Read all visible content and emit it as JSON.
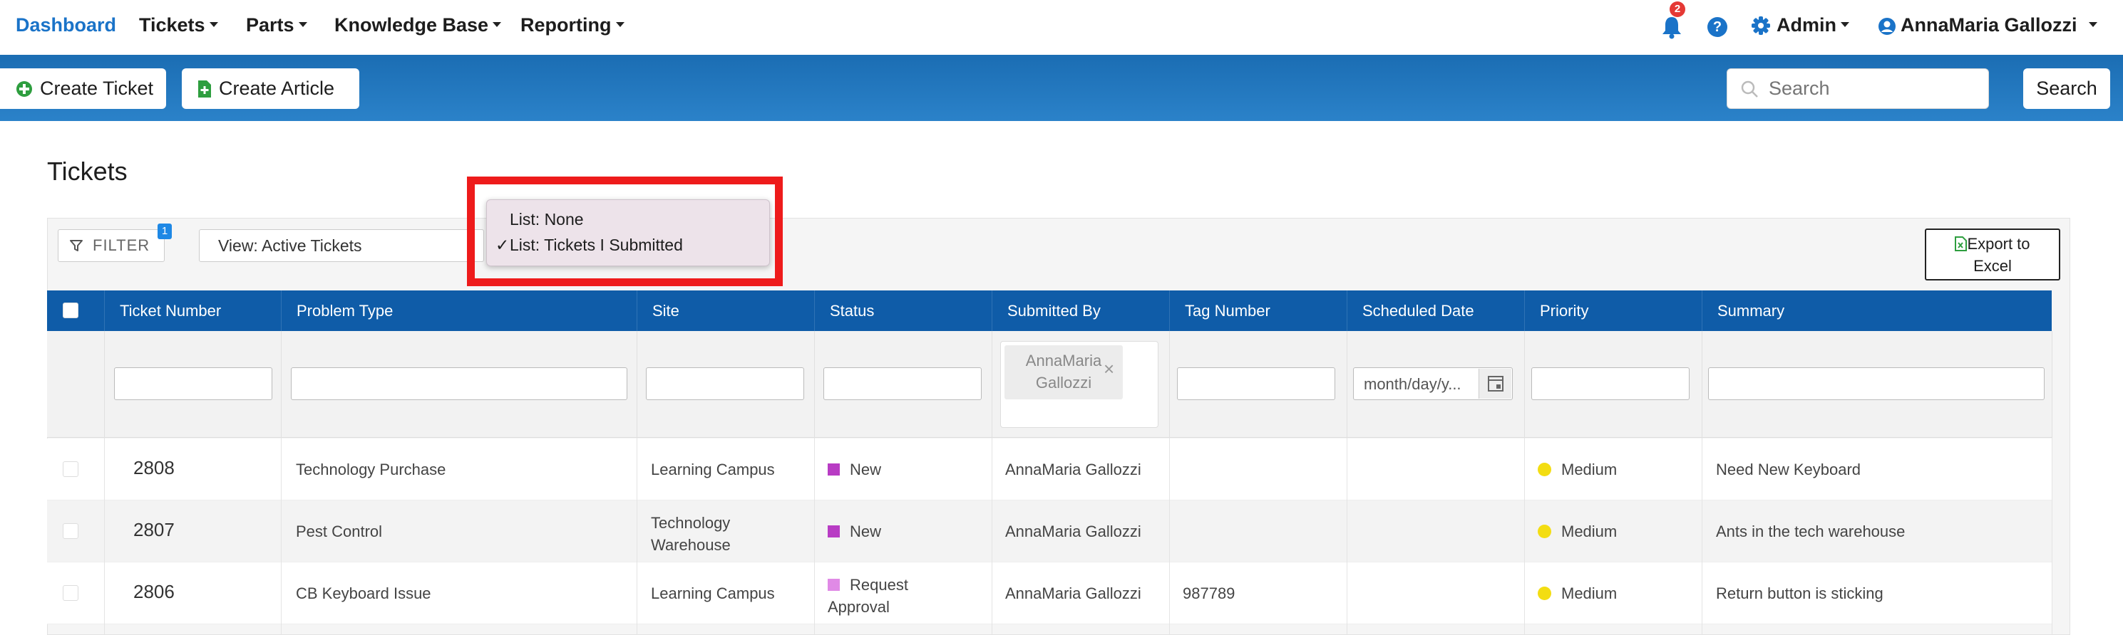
{
  "nav": {
    "brand": "Dashboard",
    "items": [
      "Tickets",
      "Parts",
      "Knowledge Base",
      "Reporting"
    ],
    "notification_count": "2",
    "help_glyph": "?",
    "admin_label": "Admin",
    "user_name": "AnnaMaria Gallozzi"
  },
  "toolbar": {
    "create_ticket": "Create Ticket",
    "create_article": "Create Article",
    "search_placeholder": "Search",
    "search_button": "Search"
  },
  "page": {
    "title": "Tickets"
  },
  "controls": {
    "filter_label": "FILTER",
    "filter_count": "1",
    "view_label": "View: Active Tickets",
    "export_line1": "Export to",
    "export_line2": "Excel"
  },
  "dropdown": {
    "items": [
      {
        "label": "List: None",
        "checked": false
      },
      {
        "label": "List: Tickets I Submitted",
        "checked": true
      }
    ],
    "check_glyph": "✓"
  },
  "table": {
    "columns": [
      "Ticket Number",
      "Problem Type",
      "Site",
      "Status",
      "Submitted By",
      "Tag Number",
      "Scheduled Date",
      "Priority",
      "Summary"
    ],
    "filters": {
      "submitted_by_chip_line1": "AnnaMaria",
      "submitted_by_chip_line2": "Gallozzi",
      "chip_remove": "×",
      "date_placeholder": "month/day/y..."
    },
    "rows": [
      {
        "ticket": "2808",
        "problem": "Technology Purchase",
        "site_l1": "Learning Campus",
        "site_l2": "",
        "status_l1": "New",
        "status_l2": "",
        "status_color": "#b83cc4",
        "submitted_by": "AnnaMaria Gallozzi",
        "tag": "",
        "scheduled": "",
        "priority": "Medium",
        "priority_color": "#f3dd12",
        "summary": "Need New Keyboard"
      },
      {
        "ticket": "2807",
        "problem": "Pest Control",
        "site_l1": "Technology",
        "site_l2": "Warehouse",
        "status_l1": "New",
        "status_l2": "",
        "status_color": "#b83cc4",
        "submitted_by": "AnnaMaria Gallozzi",
        "tag": "",
        "scheduled": "",
        "priority": "Medium",
        "priority_color": "#f3dd12",
        "summary": "Ants in the tech warehouse"
      },
      {
        "ticket": "2806",
        "problem": "CB Keyboard Issue",
        "site_l1": "Learning Campus",
        "site_l2": "",
        "status_l1": "Request",
        "status_l2": "Approval",
        "status_color": "#e08ae6",
        "submitted_by": "AnnaMaria Gallozzi",
        "tag": "987789",
        "scheduled": "",
        "priority": "Medium",
        "priority_color": "#f3dd12",
        "summary": "Return button is sticking"
      }
    ]
  },
  "colors": {
    "brand": "#1a73c8",
    "header_blue": "#0f5ca8",
    "highlight_red": "#ee1b1b",
    "add_green": "#2e9e3f"
  }
}
